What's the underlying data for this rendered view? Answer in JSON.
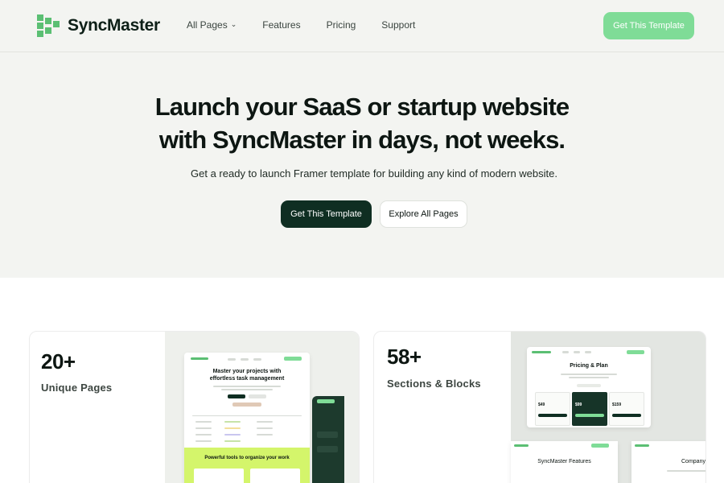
{
  "brand": {
    "name": "SyncMaster",
    "accent": "#7fdc97",
    "dark": "#0f2e22"
  },
  "nav": {
    "links": [
      {
        "label": "All Pages",
        "has_dropdown": true
      },
      {
        "label": "Features"
      },
      {
        "label": "Pricing"
      },
      {
        "label": "Support"
      }
    ],
    "cta": "Get This Template"
  },
  "hero": {
    "title_line1": "Launch your SaaS or startup website",
    "title_line2": "with SyncMaster in days, not weeks.",
    "subtitle": "Get a ready to launch Framer template for building any kind of modern website.",
    "primary_button": "Get This Template",
    "secondary_button": "Explore All Pages"
  },
  "cards": [
    {
      "number": "20+",
      "label": "Unique Pages",
      "preview": {
        "heading_line1": "Master your projects with",
        "heading_line2": "effortless task management",
        "panel_text": "Powerful tools to organize your work"
      }
    },
    {
      "number": "58+",
      "label": "Sections & Blocks",
      "preview": {
        "pricing_title": "Pricing & Plan",
        "prices": [
          "$49",
          "$99",
          "$159"
        ],
        "features_title": "SyncMaster Features",
        "company_title": "Company"
      }
    }
  ]
}
